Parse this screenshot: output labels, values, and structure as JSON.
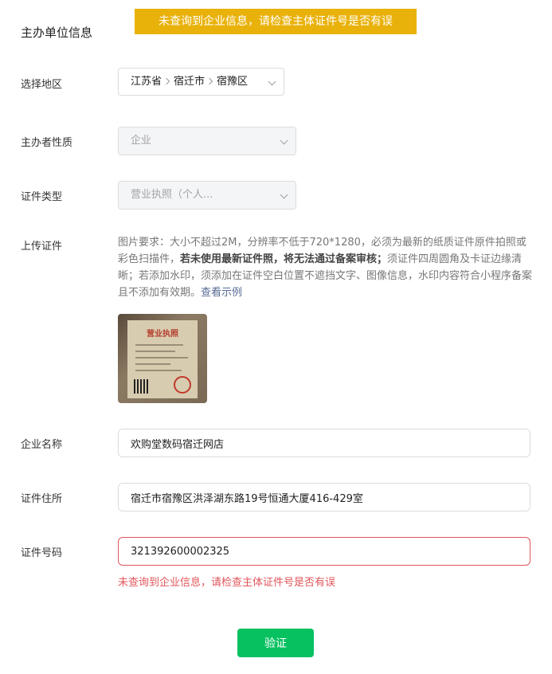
{
  "toast": {
    "message": "未查询到企业信息，请检查主体证件号是否有误"
  },
  "section": {
    "title": "主办单位信息"
  },
  "region": {
    "label": "选择地区",
    "province": "江苏省",
    "city": "宿迁市",
    "district": "宿豫区"
  },
  "nature": {
    "label": "主办者性质",
    "value": "企业"
  },
  "cert_type": {
    "label": "证件类型",
    "value": "营业执照（个人..."
  },
  "upload": {
    "label": "上传证件",
    "hint_part1": "图片要求：大小不超过2M，分辨率不低于720*1280，必须为最新的纸质证件原件拍照或彩色扫描件，",
    "hint_bold": "若未使用最新证件照，将无法通过备案审核；",
    "hint_part2": "须证件四周圆角及卡证边缘清晰；若添加水印，须添加在证件空白位置不遮挡文字、图像信息，水印内容符合小程序备案且不添加有效期。",
    "example_link": "查看示例",
    "thumb_title": "营业执照"
  },
  "company_name": {
    "label": "企业名称",
    "value": "欢购堂数码宿迁网店"
  },
  "address": {
    "label": "证件住所",
    "value": "宿迁市宿豫区洪泽湖东路19号恒通大厦416-429室"
  },
  "cert_number": {
    "label": "证件号码",
    "value": "321392600002325",
    "error": "未查询到企业信息，请检查主体证件号是否有误"
  },
  "verify_button": {
    "label": "验证"
  },
  "colors": {
    "toast_bg": "#e9b20b",
    "error": "#e0565b",
    "primary": "#07c160",
    "link": "#576b95"
  }
}
